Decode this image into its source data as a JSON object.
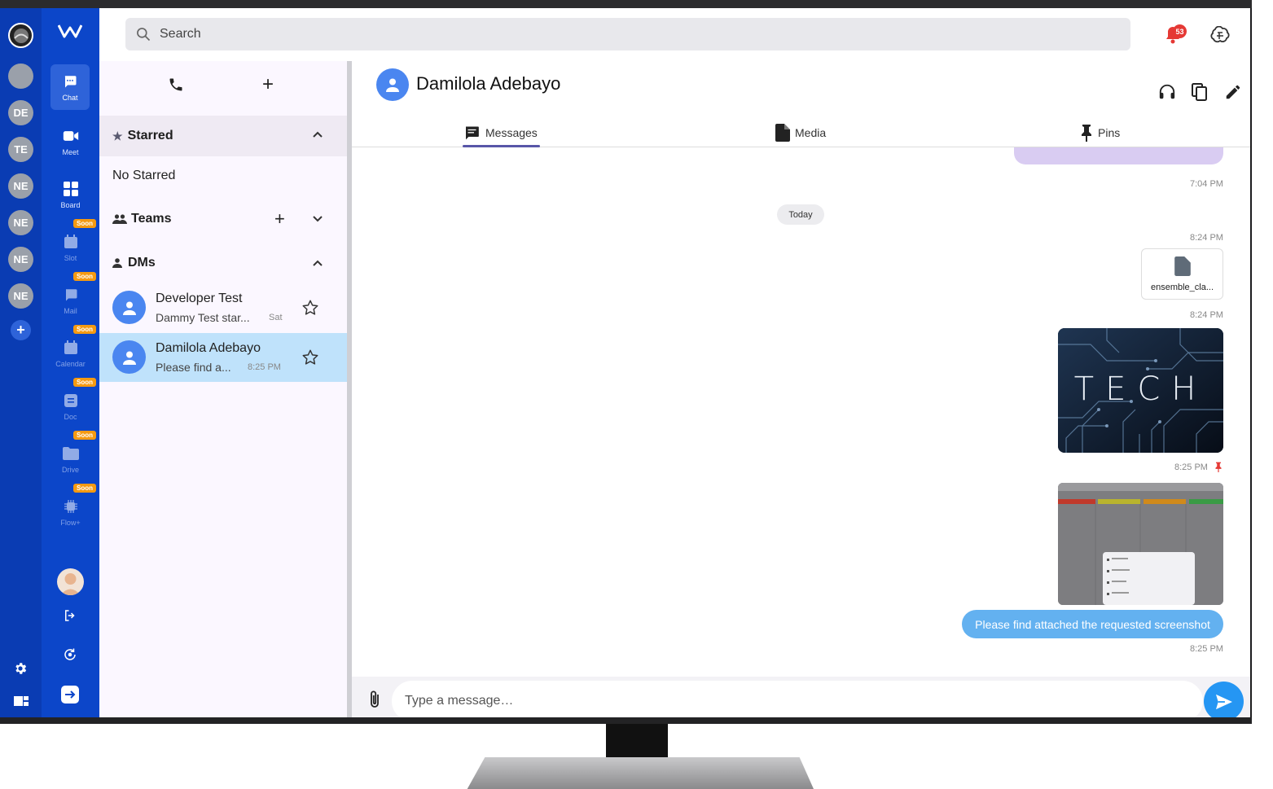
{
  "topbar": {
    "search_placeholder": "Search",
    "notification_count": "53"
  },
  "workspaces": [
    "DE",
    "TE",
    "NE",
    "NE",
    "NE",
    "NE"
  ],
  "nav": {
    "chat": "Chat",
    "meet": "Meet",
    "board": "Board",
    "slot": "Slot",
    "mail": "Mail",
    "calendar": "Calendar",
    "doc": "Doc",
    "drive": "Drive",
    "flow": "Flow+",
    "soon": "Soon"
  },
  "sidebar": {
    "starred_title": "Starred",
    "no_starred": "No Starred",
    "teams_title": "Teams",
    "dms_title": "DMs",
    "dms": [
      {
        "name": "Developer Test",
        "preview": "Dammy Test star...",
        "time": "Sat",
        "selected": false
      },
      {
        "name": "Damilola Adebayo",
        "preview": "Please find a...",
        "time": "8:25 PM",
        "selected": true
      }
    ]
  },
  "chat": {
    "contact_name": "Damilola Adebayo",
    "tabs": {
      "messages": "Messages",
      "media": "Media",
      "pins": "Pins"
    },
    "ts_1": "7:04 PM",
    "today": "Today",
    "ts_2": "8:24 PM",
    "file_name": "ensemble_cla...",
    "ts_3": "8:24 PM",
    "image_text": "TECH",
    "ts_4": "8:25 PM",
    "message_text": "Please find attached the requested screenshot",
    "ts_5": "8:25 PM",
    "composer_placeholder": "Type a message…"
  },
  "colors": {
    "rail_dark": "#0a3cb3",
    "rail": "#0c46c9",
    "accent": "#4a86f0",
    "bubble": "#63b1f0",
    "soon": "#f59a11",
    "badge": "#e53935"
  }
}
